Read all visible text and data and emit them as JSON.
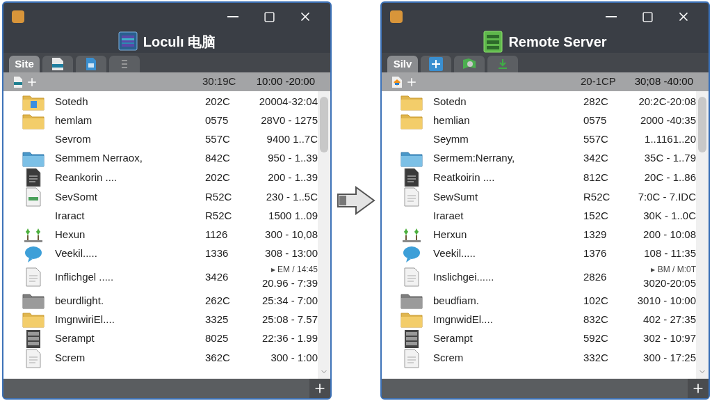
{
  "windows": [
    {
      "title": "Loculı 电脑",
      "kind": "monitor",
      "tabs": [
        {
          "label": "Site",
          "selected": true
        },
        {
          "kind": "image-doc",
          "selected": false
        },
        {
          "kind": "blue-doc",
          "selected": false
        },
        {
          "kind": "lines",
          "selected": false
        }
      ],
      "toolbar": {
        "kind": "teal-doc",
        "column_2": "30:19C",
        "column_3": "10:00 -20:00"
      },
      "rows": [
        {
          "kind": "folder-doc",
          "name": "Sotedh",
          "column_2": "202C",
          "column_3": "20004-32:04"
        },
        {
          "kind": "folder",
          "name": "hemlam",
          "column_2": "0575",
          "column_3": "28V0 - 1275"
        },
        {
          "kind": "none",
          "name": "Sevrom",
          "column_2": "557C",
          "column_3": "9400 1..7C"
        },
        {
          "kind": "folder-blue",
          "name": "Semmem Nerraox,",
          "column_2": "842C",
          "column_3": "950 - 1..39"
        },
        {
          "kind": "disk",
          "name": "Reankorin ....",
          "column_2": "202C",
          "column_3": "200 - 1..39"
        },
        {
          "kind": "doc-green",
          "name": "SevSomt",
          "column_2": "R52C",
          "column_3": "230 - 1..5C"
        },
        {
          "kind": "none",
          "name": "Iraract",
          "column_2": "R52C",
          "column_3": "1500 1..09"
        },
        {
          "kind": "plant",
          "name": "Hexun",
          "column_2": "1126",
          "column_3": "300 - 10,08"
        },
        {
          "kind": "bubble",
          "name": "Veekil.....",
          "column_2": "1336",
          "column_3": "308 - 13:00"
        },
        {
          "kind": "doc",
          "name": "Inflichgel .....",
          "column_2": "3426",
          "column_3": "20.96 - 7:39",
          "note": "▸ EM / 14:45"
        },
        {
          "kind": "folder-gray",
          "name": "beurdlight.",
          "column_2": "262C",
          "column_3": "25:34 - 7:00"
        },
        {
          "kind": "folder",
          "name": "ImgnwiriEl....",
          "column_2": "3325",
          "column_3": "25:08 - 7.57"
        },
        {
          "kind": "server",
          "name": "Serampt",
          "column_2": "8025",
          "column_3": "22:36 - 1.99"
        },
        {
          "kind": "doc",
          "name": "Screm",
          "column_2": "362C",
          "column_3": "300 - 1:00"
        }
      ]
    },
    {
      "title": "Remote Server",
      "kind": "server",
      "tabs": [
        {
          "label": "Silv",
          "selected": true
        },
        {
          "kind": "plus-tile",
          "selected": false
        },
        {
          "kind": "map",
          "selected": false
        },
        {
          "kind": "download",
          "selected": false
        }
      ],
      "toolbar": {
        "kind": "orange-doc",
        "column_2": "20-1CP",
        "column_3": "30;08 -40:00"
      },
      "rows": [
        {
          "kind": "folder",
          "name": "Sotedn",
          "column_2": "282C",
          "column_3": "20:2C-20:08"
        },
        {
          "kind": "folder",
          "name": "hemlian",
          "column_2": "0575",
          "column_3": "2000 -40:35"
        },
        {
          "kind": "none",
          "name": "Seymm",
          "column_2": "557C",
          "column_3": "1..1161..20"
        },
        {
          "kind": "folder-blue",
          "name": "Sermem:Nerrany,",
          "column_2": "342C",
          "column_3": "35C - 1..79"
        },
        {
          "kind": "disk",
          "name": "Reatkoirin ....",
          "column_2": "812C",
          "column_3": "20C - 1..86"
        },
        {
          "kind": "doc",
          "name": "SewSumt",
          "column_2": "R52C",
          "column_3": "7:0C - 7.IDC"
        },
        {
          "kind": "none",
          "name": "Iraraet",
          "column_2": "152C",
          "column_3": "30K - 1..0C"
        },
        {
          "kind": "plant",
          "name": "Herxun",
          "column_2": "1329",
          "column_3": "200 - 10:08"
        },
        {
          "kind": "bubble",
          "name": "Veekil.....",
          "column_2": "1376",
          "column_3": "108 - 11:35"
        },
        {
          "kind": "doc",
          "name": "Inslichgei......",
          "column_2": "2826",
          "column_3": "3020-20:05",
          "note": "▸ BM / M:0T"
        },
        {
          "kind": "folder-gray",
          "name": "beudfiam.",
          "column_2": "102C",
          "column_3": "3010 - 10:00"
        },
        {
          "kind": "folder",
          "name": "ImgnwidEl....",
          "column_2": "832C",
          "column_3": "402 - 27:35"
        },
        {
          "kind": "server",
          "name": "Serampt",
          "column_2": "592C",
          "column_3": "302 - 10:97"
        },
        {
          "kind": "doc",
          "name": "Screm",
          "column_2": "332C",
          "column_3": "300 - 17:25"
        }
      ]
    }
  ]
}
